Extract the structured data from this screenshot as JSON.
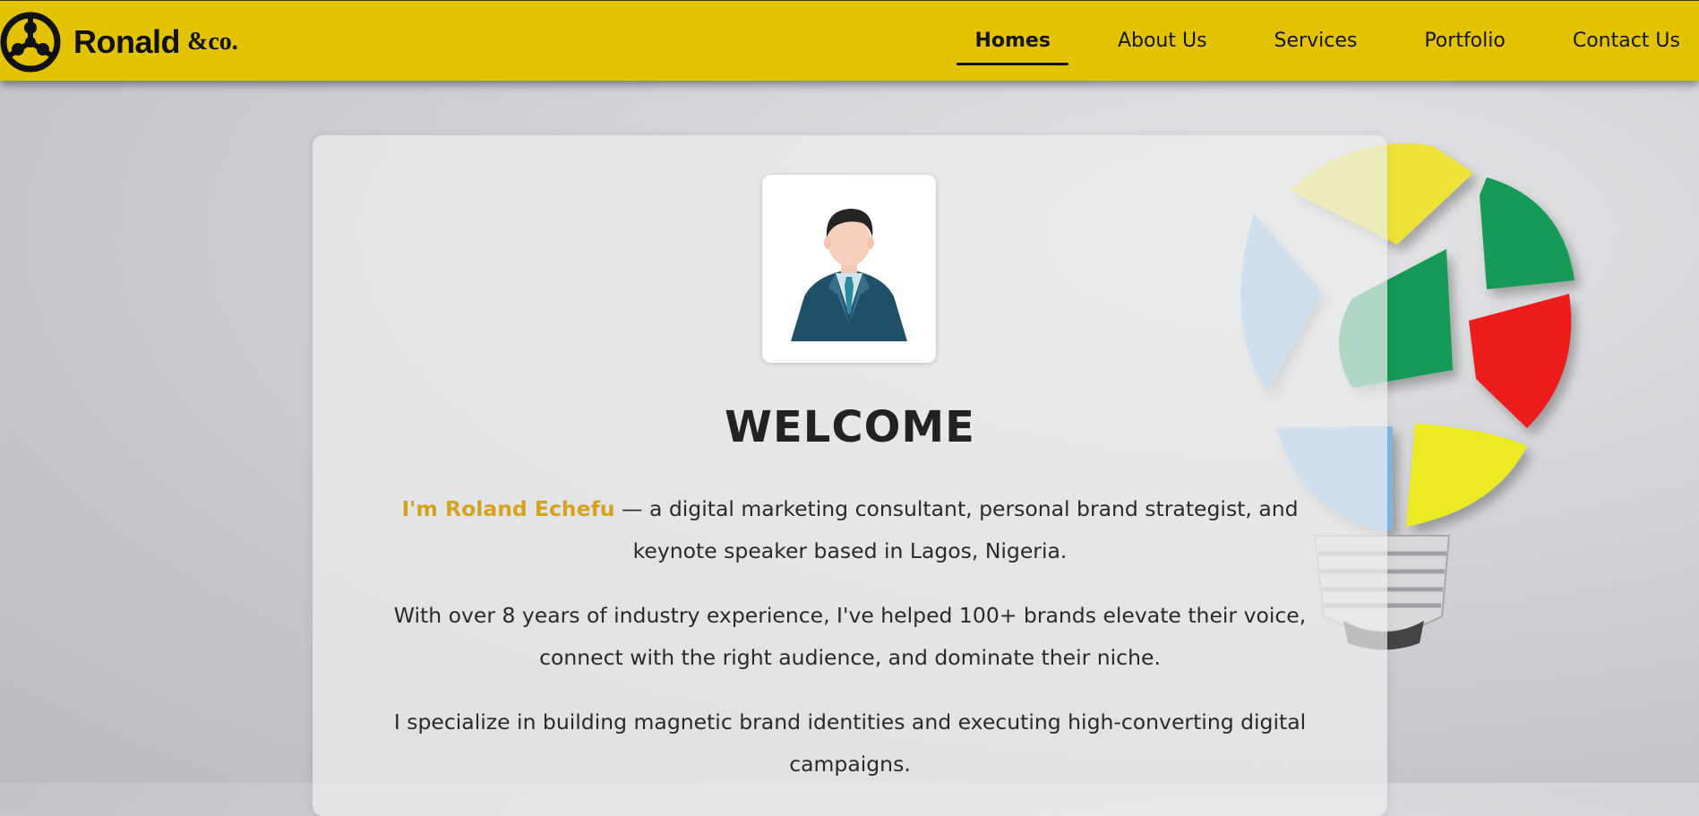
{
  "header": {
    "brand_name": "Ronald",
    "brand_suffix": "&co.",
    "nav": [
      {
        "label": "Homes",
        "active": true
      },
      {
        "label": "About Us",
        "active": false
      },
      {
        "label": "Services",
        "active": false
      },
      {
        "label": "Portfolio",
        "active": false
      },
      {
        "label": "Contact Us",
        "active": false
      }
    ]
  },
  "hero": {
    "title": "WELCOME",
    "intro_name": "I'm Roland Echefu",
    "intro_rest": " — a digital marketing consultant, personal brand strategist, and keynote speaker based in Lagos, Nigeria.",
    "paragraph2": "With over 8 years of industry experience, I've helped 100+ brands elevate their voice, connect with the right audience, and dominate their niche.",
    "paragraph3": "I specialize in building magnetic brand identities and executing high-converting digital campaigns."
  },
  "icons": {
    "logo": "wheel-logo-icon",
    "avatar": "businessman-avatar-icon",
    "decoration": "puzzle-lightbulb-icon"
  },
  "colors": {
    "navbar": "#e3c200",
    "highlight": "#d6a21e",
    "text": "#2a2a2a"
  }
}
